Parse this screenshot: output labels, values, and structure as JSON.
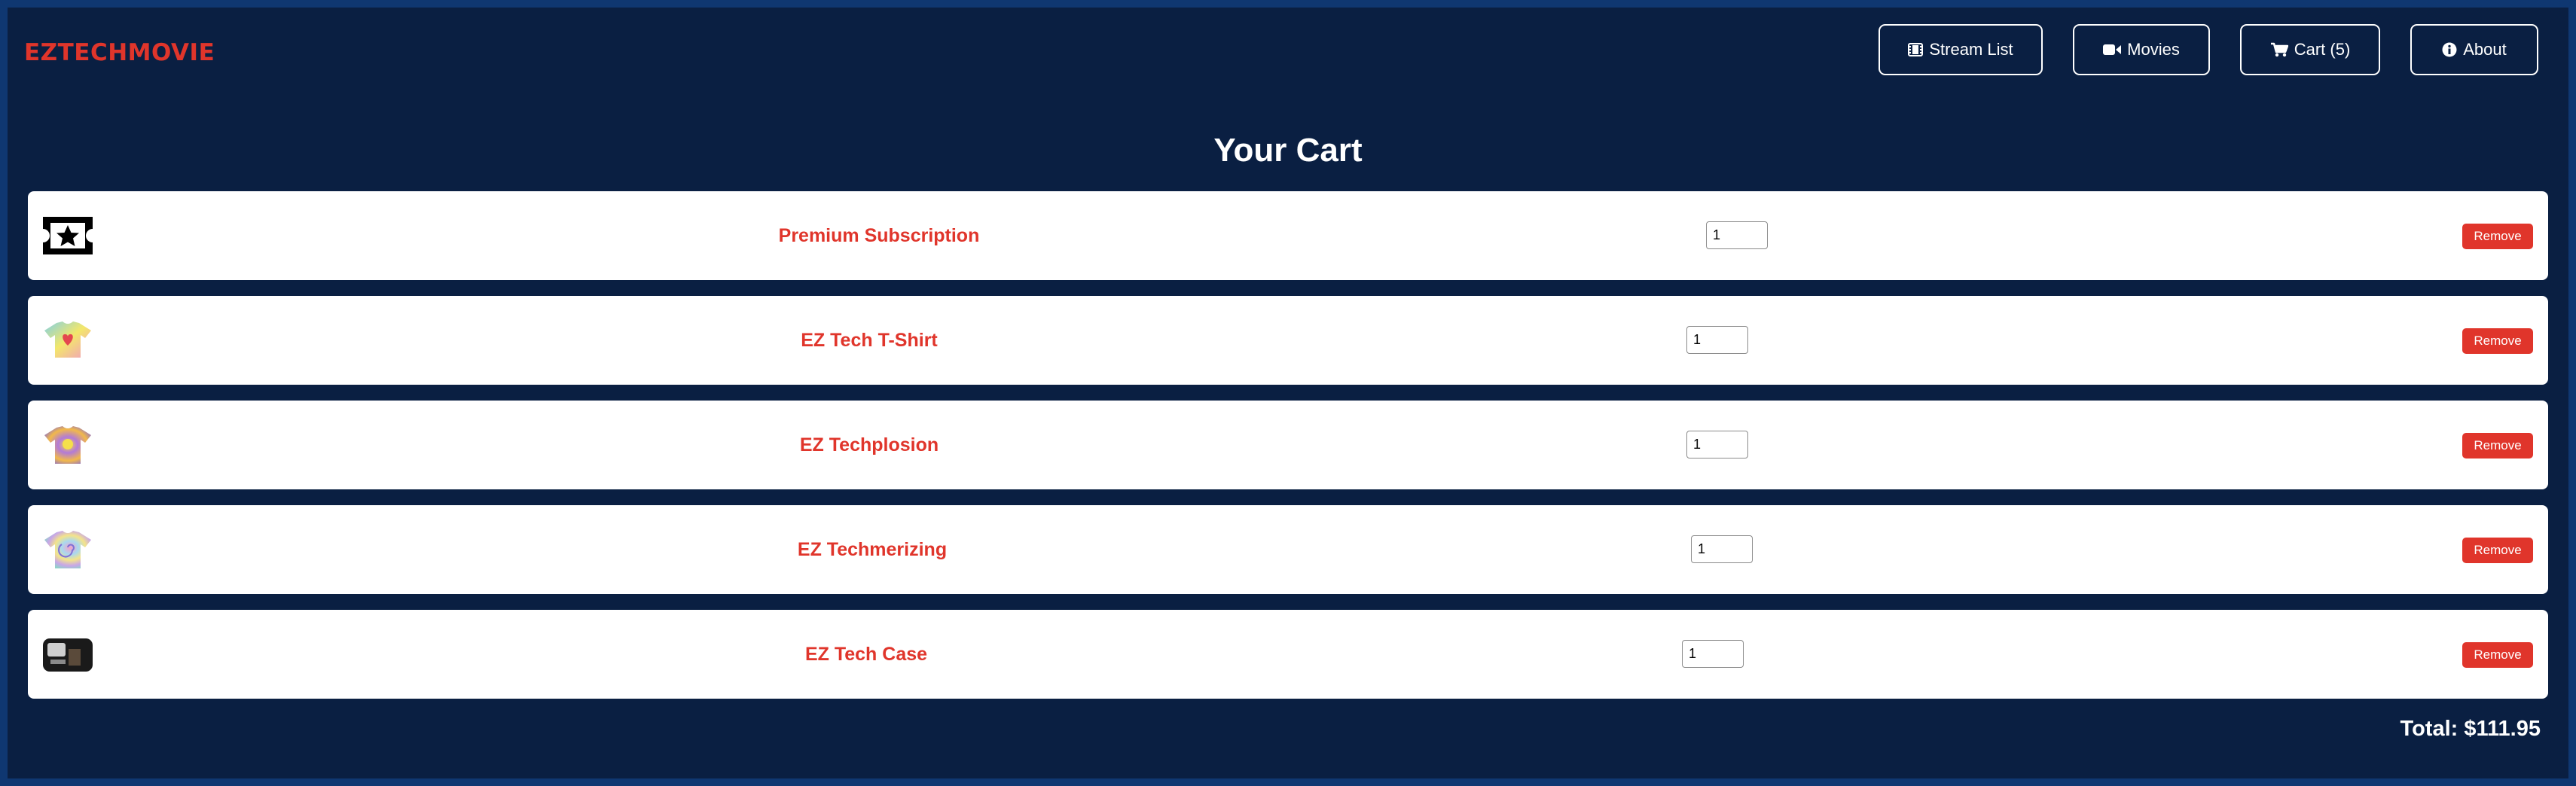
{
  "header": {
    "logo": "EZTECHMOVIE",
    "nav": [
      {
        "label": "Stream List",
        "icon": "film-icon"
      },
      {
        "label": "Movies",
        "icon": "video-camera-icon"
      },
      {
        "label": "Cart (5)",
        "icon": "shopping-cart-icon"
      },
      {
        "label": "About",
        "icon": "info-circle-icon"
      }
    ]
  },
  "main": {
    "title": "Your Cart",
    "items": [
      {
        "name": "Premium Subscription",
        "quantity": "1",
        "remove_label": "Remove",
        "thumbnail": "ticket-star-icon"
      },
      {
        "name": "EZ Tech T-Shirt",
        "quantity": "1",
        "remove_label": "Remove",
        "thumbnail": "tshirt-heart-image"
      },
      {
        "name": "EZ Techplosion",
        "quantity": "1",
        "remove_label": "Remove",
        "thumbnail": "tshirt-tiedye-burst-image"
      },
      {
        "name": "EZ Techmerizing",
        "quantity": "1",
        "remove_label": "Remove",
        "thumbnail": "tshirt-spiral-image"
      },
      {
        "name": "EZ Tech Case",
        "quantity": "1",
        "remove_label": "Remove",
        "thumbnail": "phone-case-image"
      }
    ],
    "total": "Total: $111.95"
  },
  "colors": {
    "background": "#0a1f42",
    "frame": "#0f3771",
    "accent": "#e0352b",
    "card": "#ffffff"
  }
}
